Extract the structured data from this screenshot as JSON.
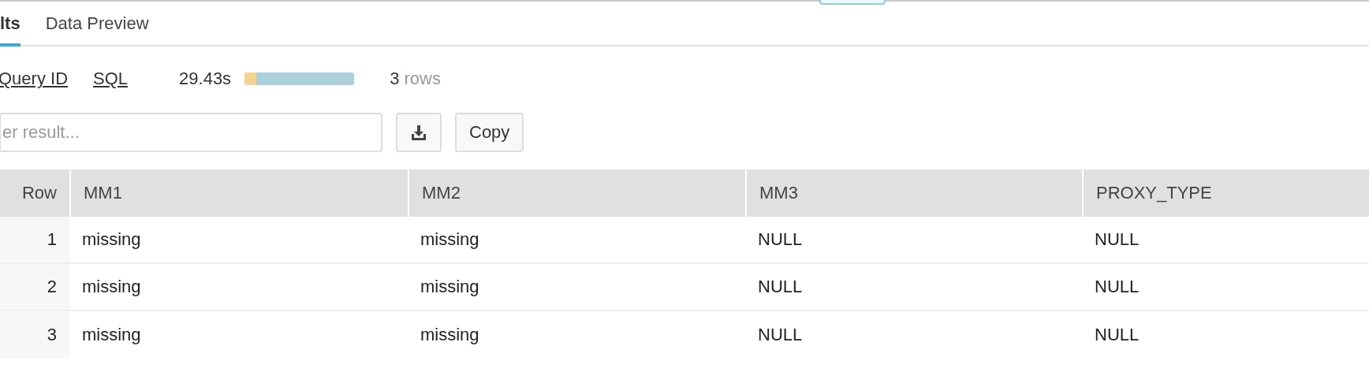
{
  "tabs": [
    {
      "label": "lts",
      "selected": true
    },
    {
      "label": "Data Preview",
      "selected": false
    }
  ],
  "info": {
    "query_id_link": "Query ID",
    "sql_link": "SQL",
    "duration": "29.43s",
    "timing_bar": {
      "level": 0.11
    },
    "row_count": "3",
    "row_unit": "rows"
  },
  "filter": {
    "placeholder": "er result..."
  },
  "copy_button": "Copy",
  "table": {
    "columns": [
      "Row",
      "MM1",
      "MM2",
      "MM3",
      "PROXY_TYPE"
    ],
    "rows": [
      [
        "1",
        "missing",
        "missing",
        "NULL",
        "NULL"
      ],
      [
        "2",
        "missing",
        "missing",
        "NULL",
        "NULL"
      ],
      [
        "3",
        "missing",
        "missing",
        "NULL",
        "NULL"
      ]
    ]
  }
}
